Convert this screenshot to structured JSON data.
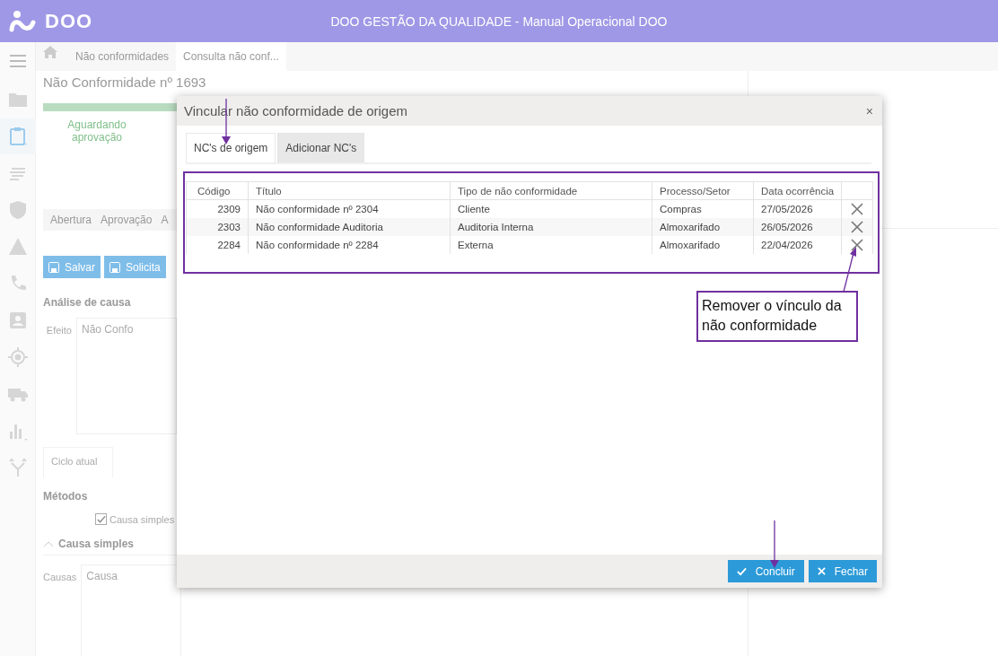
{
  "app": {
    "logo": "DOO",
    "title": "DOO GESTÃO DA QUALIDADE - Manual Operacional DOO"
  },
  "sidebar": {
    "items": [
      {
        "kind": "folder",
        "selected": false
      },
      {
        "kind": "clipboard",
        "selected": true
      },
      {
        "kind": "lines",
        "selected": false
      },
      {
        "kind": "shield",
        "selected": false
      },
      {
        "kind": "warning",
        "selected": false
      },
      {
        "kind": "phone",
        "selected": false
      },
      {
        "kind": "contact",
        "selected": false
      },
      {
        "kind": "target",
        "selected": false
      },
      {
        "kind": "truck",
        "selected": false
      },
      {
        "kind": "chart",
        "selected": false
      },
      {
        "kind": "fork",
        "selected": false
      }
    ]
  },
  "breadcrumb": [
    {
      "label": "Não conformidades",
      "selected": false
    },
    {
      "label": "Consulta não conf...",
      "selected": true
    }
  ],
  "record": {
    "heading": "Não Conformidade nº 1693",
    "progress": {
      "level": 1
    },
    "status": "Aguardando aprovação"
  },
  "tabs": [
    {
      "label": "Abertura"
    },
    {
      "label": "Aprovação"
    },
    {
      "label": "A"
    }
  ],
  "buttons": [
    "Salvar",
    "Solicita"
  ],
  "cause_analysis": {
    "title": "Análise de causa",
    "effect_label": "Efeito",
    "effect_value": "Não Confo"
  },
  "cycle_tab": "Ciclo atual",
  "methods": {
    "title": "Métodos",
    "options": [
      {
        "label": "Causa simples",
        "checked": true
      }
    ]
  },
  "simple_cause": {
    "title": "Causa simples",
    "expanded": true,
    "label": "Causas",
    "value": "Causa"
  },
  "dialog": {
    "title": "Vincular não conformidade de origem",
    "close": "×",
    "tabs": [
      {
        "label": "NC's de origem",
        "selected": true
      },
      {
        "label": "Adicionar NC's",
        "selected": false
      }
    ],
    "columns": [
      "Código",
      "Título",
      "Tipo de não conformidade",
      "Processo/Setor",
      "Data ocorrência"
    ],
    "rows": [
      {
        "code": "2309",
        "title": "Não conformidade nº 2304",
        "type": "Cliente",
        "process": "Compras",
        "date": "27/05/2026"
      },
      {
        "code": "2303",
        "title": "Não conformidade Auditoria",
        "type": "Auditoria Interna",
        "process": "Almoxarifado",
        "date": "26/05/2026"
      },
      {
        "code": "2284",
        "title": "Não conformidade nº 2284",
        "type": "Externa",
        "process": "Almoxarifado",
        "date": "22/04/2026"
      }
    ],
    "buttons": [
      {
        "kind": "confirm",
        "label": "Concluir"
      },
      {
        "kind": "close",
        "label": "Fechar"
      }
    ]
  },
  "annotation": {
    "callout": "Remover o vínculo da não conformidade"
  }
}
